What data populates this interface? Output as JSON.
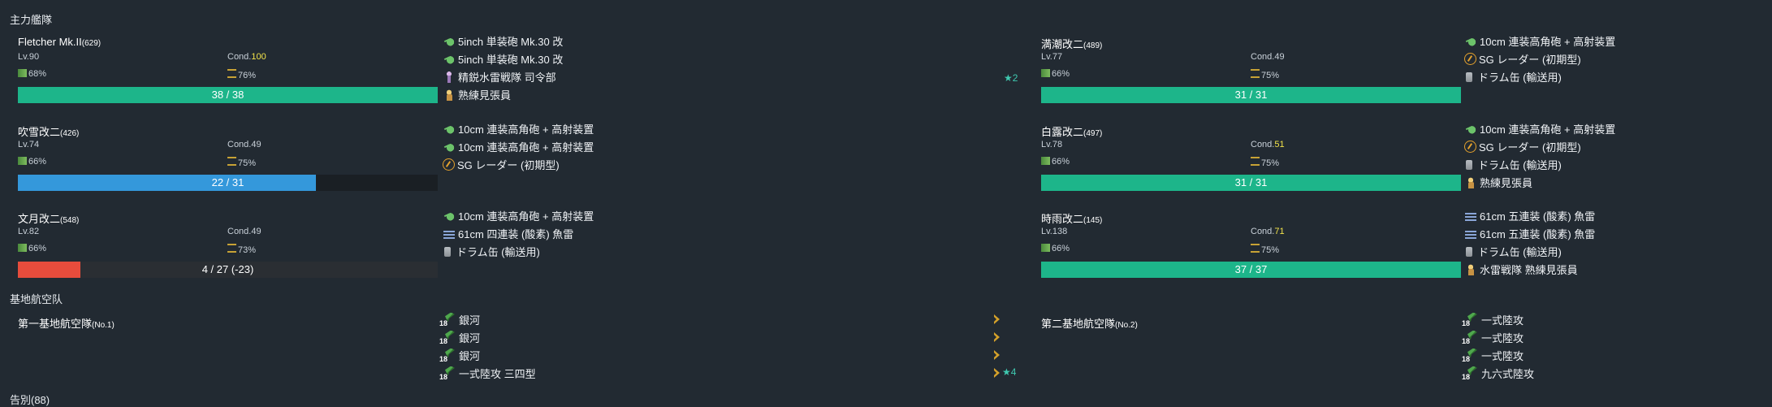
{
  "sections": {
    "main_fleet": "主力艦隊",
    "air_base": "基地航空队",
    "bottom_partial": "告別(88)"
  },
  "colors": {
    "hp_green": "#1db58a",
    "hp_blue": "#3498db",
    "hp_red": "#e74c3c",
    "bar_track": "#1b1f24",
    "star": "#3fc9b0",
    "chevron": "#d4a12a"
  },
  "ships": [
    {
      "name": "Fletcher Mk.II",
      "id": "(629)",
      "lv": "Lv.90",
      "cond_label": "Cond.",
      "cond": "100",
      "cond_high": true,
      "fuel": "68%",
      "ammo": "76%",
      "hp_text": "38 / 38",
      "hp_ratio": 1.0,
      "hp_color": "green",
      "equip": [
        {
          "icon": "gun-icon",
          "name": "5inch 単装砲 Mk.30 改"
        },
        {
          "icon": "gun-icon",
          "name": "5inch 単装砲 Mk.30 改"
        },
        {
          "icon": "submarine-crew-icon",
          "name": "精鋭水雷戦隊 司令部",
          "star": "★2"
        },
        {
          "icon": "lookout-icon",
          "name": "熟練見張員"
        }
      ]
    },
    {
      "name": "吹雪改二",
      "id": "(426)",
      "lv": "Lv.74",
      "cond_label": "Cond.",
      "cond": "49",
      "cond_high": false,
      "fuel": "66%",
      "ammo": "75%",
      "hp_text": "22 / 31",
      "hp_ratio": 0.7097,
      "hp_color": "blue",
      "equip": [
        {
          "icon": "gun-icon",
          "name": "10cm 連装高角砲 + 高射装置"
        },
        {
          "icon": "gun-icon",
          "name": "10cm 連装高角砲 + 高射装置"
        },
        {
          "icon": "radar-icon",
          "name": "SG レーダー (初期型)"
        }
      ]
    },
    {
      "name": "文月改二",
      "id": "(548)",
      "lv": "Lv.82",
      "cond_label": "Cond.",
      "cond": "49",
      "cond_high": false,
      "fuel": "66%",
      "ammo": "73%",
      "hp_text": "4 / 27 (-23)",
      "hp_ratio": 0.148,
      "hp_color": "red",
      "equip": [
        {
          "icon": "gun-icon",
          "name": "10cm 連装高角砲 + 高射装置"
        },
        {
          "icon": "torpedo-icon",
          "name": "61cm 四連装 (酸素) 魚雷"
        },
        {
          "icon": "drum-icon",
          "name": "ドラム缶 (輸送用)"
        }
      ]
    },
    {
      "name": "満潮改二",
      "id": "(489)",
      "lv": "Lv.77",
      "cond_label": "Cond.",
      "cond": "49",
      "cond_high": false,
      "fuel": "66%",
      "ammo": "75%",
      "hp_text": "31 / 31",
      "hp_ratio": 1.0,
      "hp_color": "green",
      "equip": [
        {
          "icon": "gun-icon",
          "name": "10cm 連装高角砲 + 高射装置"
        },
        {
          "icon": "radar-icon",
          "name": "SG レーダー (初期型)"
        },
        {
          "icon": "drum-icon",
          "name": "ドラム缶 (輸送用)"
        }
      ]
    },
    {
      "name": "白露改二",
      "id": "(497)",
      "lv": "Lv.78",
      "cond_label": "Cond.",
      "cond": "51",
      "cond_high": true,
      "fuel": "66%",
      "ammo": "75%",
      "hp_text": "31 / 31",
      "hp_ratio": 1.0,
      "hp_color": "green",
      "equip": [
        {
          "icon": "gun-icon",
          "name": "10cm 連装高角砲 + 高射装置"
        },
        {
          "icon": "radar-icon",
          "name": "SG レーダー (初期型)"
        },
        {
          "icon": "drum-icon",
          "name": "ドラム缶 (輸送用)"
        },
        {
          "icon": "lookout-icon",
          "name": "熟練見張員"
        }
      ]
    },
    {
      "name": "時雨改二",
      "id": "(145)",
      "lv": "Lv.138",
      "cond_label": "Cond.",
      "cond": "71",
      "cond_high": true,
      "fuel": "66%",
      "ammo": "75%",
      "hp_text": "37 / 37",
      "hp_ratio": 1.0,
      "hp_color": "green",
      "equip": [
        {
          "icon": "torpedo-icon",
          "name": "61cm 五連装 (酸素) 魚雷"
        },
        {
          "icon": "torpedo-icon",
          "name": "61cm 五連装 (酸素) 魚雷"
        },
        {
          "icon": "drum-icon",
          "name": "ドラム缶 (輸送用)"
        },
        {
          "icon": "lookout-icon",
          "name": "水雷戦隊 熟練見張員"
        }
      ]
    }
  ],
  "air_corps": [
    {
      "name": "第一基地航空隊",
      "id": "(No.1)",
      "planes": [
        {
          "count": "18",
          "name": "銀河"
        },
        {
          "count": "18",
          "name": "銀河"
        },
        {
          "count": "18",
          "name": "銀河"
        },
        {
          "count": "18",
          "name": "一式陸攻 三四型",
          "star": "★4"
        }
      ]
    },
    {
      "name": "第二基地航空隊",
      "id": "(No.2)",
      "planes": [
        {
          "count": "18",
          "name": "一式陸攻"
        },
        {
          "count": "18",
          "name": "一式陸攻"
        },
        {
          "count": "18",
          "name": "一式陸攻"
        },
        {
          "count": "18",
          "name": "九六式陸攻"
        }
      ]
    }
  ]
}
